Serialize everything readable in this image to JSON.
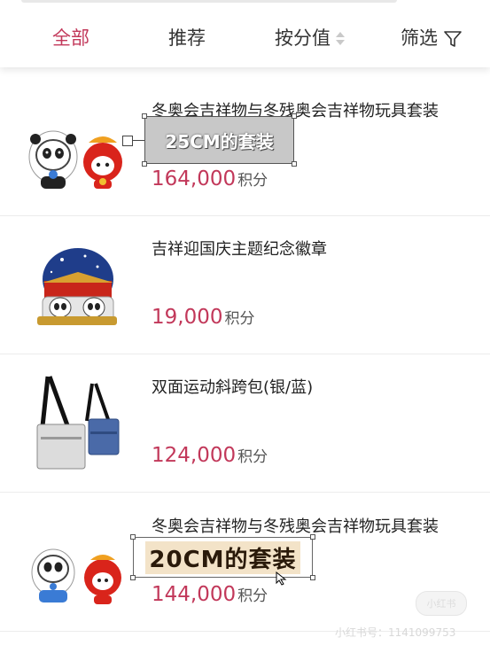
{
  "tabs": {
    "all": "全部",
    "recommended": "推荐",
    "by_points": "按分值",
    "filter": "筛选"
  },
  "colors": {
    "accent": "#c2385a"
  },
  "products": [
    {
      "title": "冬奥会吉祥物与冬残奥会吉祥物玩具套装",
      "price": "164,000",
      "unit": "积分",
      "image": "mascot-plush-set"
    },
    {
      "title": "吉祥迎国庆主题纪念徽章",
      "price": "19,000",
      "unit": "积分",
      "image": "national-day-badge"
    },
    {
      "title": "双面运动斜跨包(银/蓝)",
      "price": "124,000",
      "unit": "积分",
      "image": "crossbody-bags"
    },
    {
      "title": "冬奥会吉祥物与冬残奥会吉祥物玩具套装",
      "price": "144,000",
      "unit": "积分",
      "image": "mascot-plush-set"
    }
  ],
  "annotations": {
    "first": "25CM的套装",
    "second": "20CM的套装"
  },
  "watermark": {
    "button": "小红书",
    "text": "小红书号：1141099753"
  }
}
